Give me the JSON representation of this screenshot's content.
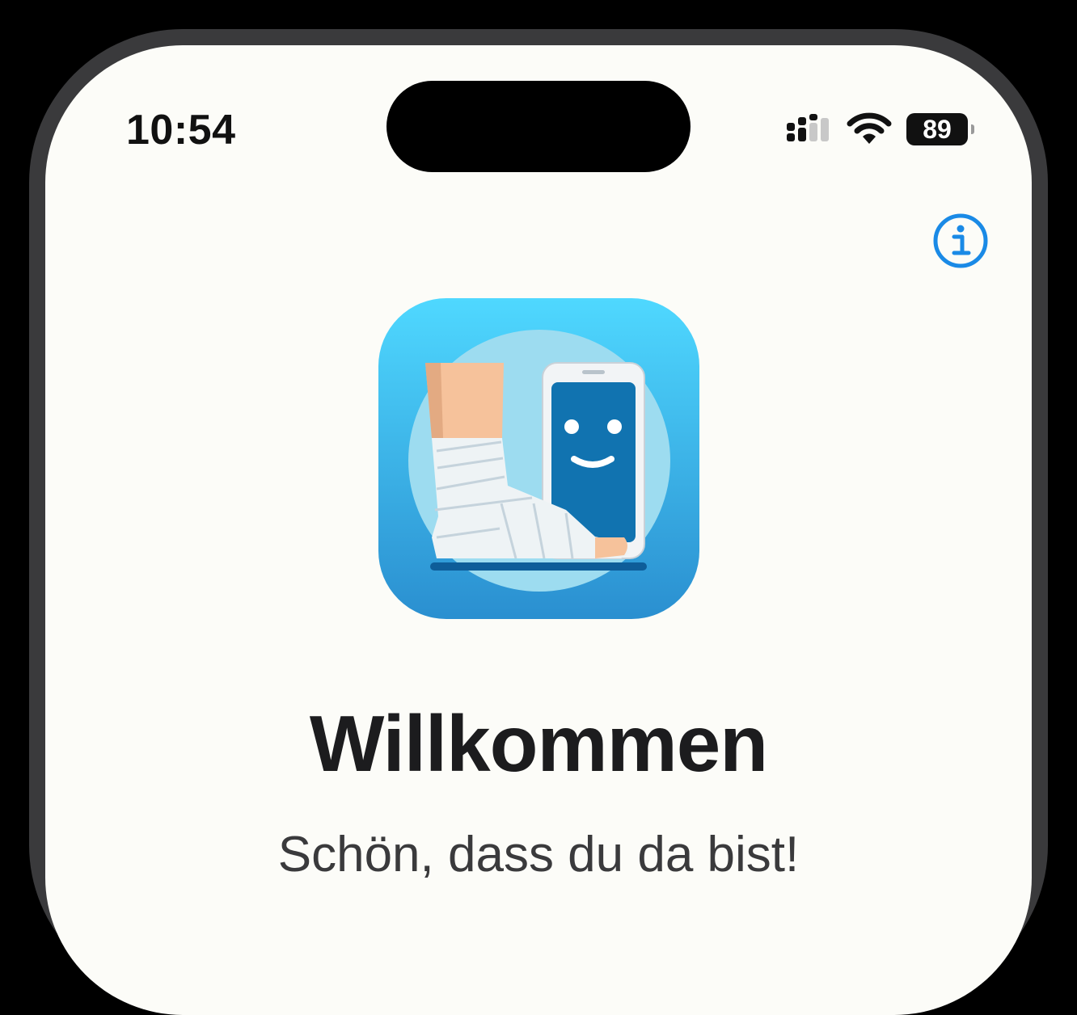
{
  "status_bar": {
    "time": "10:54",
    "battery_level": "89",
    "signal_icon": "cellular-signal-icon",
    "wifi_icon": "wifi-icon"
  },
  "header": {
    "info_icon": "info-circle-icon"
  },
  "app_icon": {
    "name": "app-logo-bandaged-foot-with-smiling-phone"
  },
  "welcome": {
    "title": "Willkommen",
    "subtitle": "Schön, dass du da bist!"
  },
  "colors": {
    "accent": "#1a8ae6",
    "background": "#fcfcf8",
    "icon_gradient_top": "#4fd8ff",
    "icon_gradient_bottom": "#2a8fd0",
    "phone_screen": "#1173b0"
  }
}
